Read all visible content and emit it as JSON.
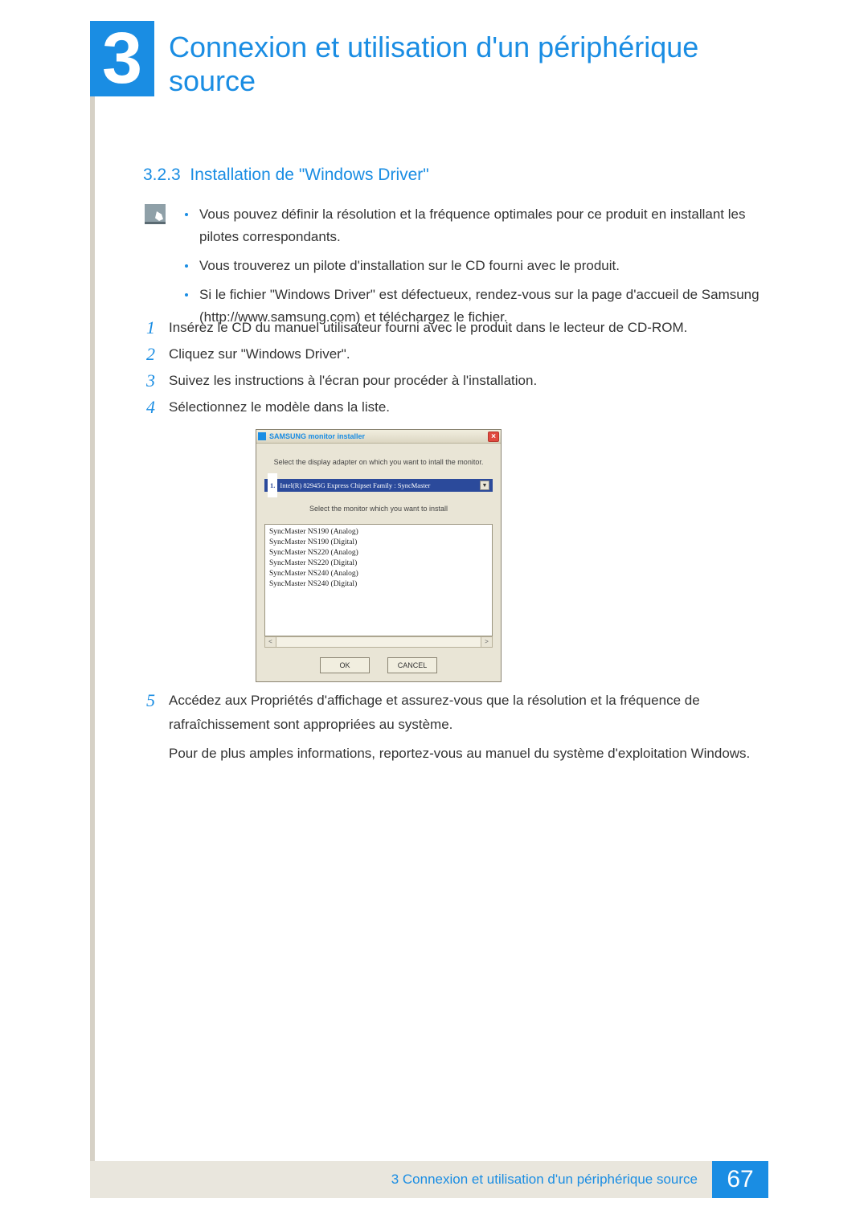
{
  "chapter": {
    "number": "3",
    "title": "Connexion et utilisation d'un périphérique source"
  },
  "section": {
    "number": "3.2.3",
    "title": "Installation de \"Windows Driver\""
  },
  "notes": [
    "Vous pouvez définir la résolution et la fréquence optimales pour ce produit en installant les pilotes correspondants.",
    "Vous trouverez un pilote d'installation sur le CD fourni avec le produit.",
    "Si le fichier \"Windows Driver\" est défectueux, rendez-vous sur la page d'accueil de Samsung (http://www.samsung.com) et téléchargez le fichier."
  ],
  "steps": [
    {
      "n": "1",
      "text": "Insérez le CD du manuel utilisateur fourni avec le produit dans le lecteur de CD-ROM."
    },
    {
      "n": "2",
      "text": "Cliquez sur \"Windows Driver\"."
    },
    {
      "n": "3",
      "text": "Suivez les instructions à l'écran pour procéder à l'installation."
    },
    {
      "n": "4",
      "text": "Sélectionnez le modèle dans la liste."
    },
    {
      "n": "5",
      "text": "Accédez aux Propriétés d'affichage et assurez-vous que la résolution et la fréquence de rafraîchissement sont appropriées au système.",
      "text2": "Pour de plus amples informations, reportez-vous au manuel du système d'exploitation Windows."
    }
  ],
  "installer": {
    "title": "SAMSUNG monitor installer",
    "line1": "Select the display adapter on which you want to intall the monitor.",
    "dropdown_num": "1.",
    "dropdown": "Intel(R) 82945G Express Chipset Family : SyncMaster",
    "line2": "Select the monitor which you want to install",
    "list": [
      "SyncMaster NS190 (Analog)",
      "SyncMaster NS190 (Digital)",
      "SyncMaster NS220 (Analog)",
      "SyncMaster NS220 (Digital)",
      "SyncMaster NS240 (Analog)",
      "SyncMaster NS240 (Digital)"
    ],
    "ok": "OK",
    "cancel": "CANCEL"
  },
  "footer": {
    "label": "3 Connexion et utilisation d'un périphérique source",
    "page": "67"
  }
}
